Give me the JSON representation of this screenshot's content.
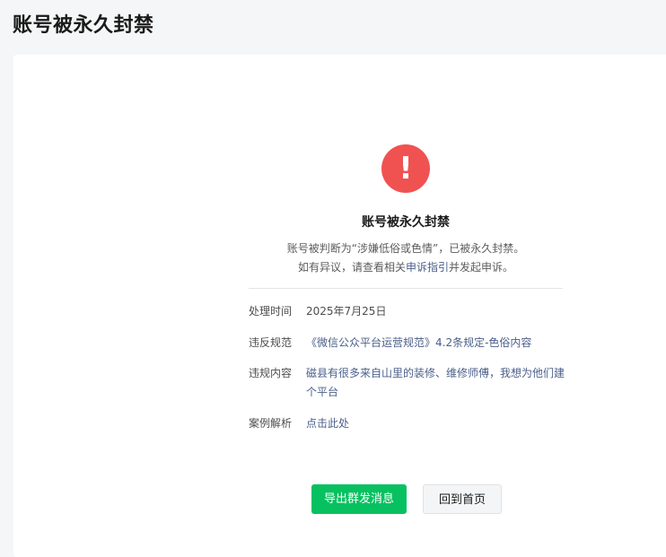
{
  "page": {
    "title": "账号被永久封禁"
  },
  "notice": {
    "icon": "exclamation-icon",
    "icon_symbol": "!",
    "icon_color": "#f05252",
    "title": "账号被永久封禁",
    "line1": "账号被判断为“涉嫌低俗或色情”，已被永久封禁。",
    "line2_prefix": "如有异议，请查看相关",
    "line2_link": "申诉指引",
    "line2_suffix": "并发起申诉。"
  },
  "details": [
    {
      "label": "处理时间",
      "value": "2025年7月25日"
    },
    {
      "label": "违反规范",
      "value": "《微信公众平台运营规范》4.2条规定-色俗内容"
    },
    {
      "label": "违规内容",
      "value": "磁县有很多来自山里的装修、维修师傅，我想为他们建个平台"
    },
    {
      "label": "案例解析",
      "value": "点击此处"
    }
  ],
  "buttons": {
    "primary_label": "导出群发消息",
    "secondary_label": "回到首页"
  },
  "colors": {
    "accent_green": "#07c160",
    "link_blue": "#4a5f8a",
    "alert_red": "#f05252"
  }
}
